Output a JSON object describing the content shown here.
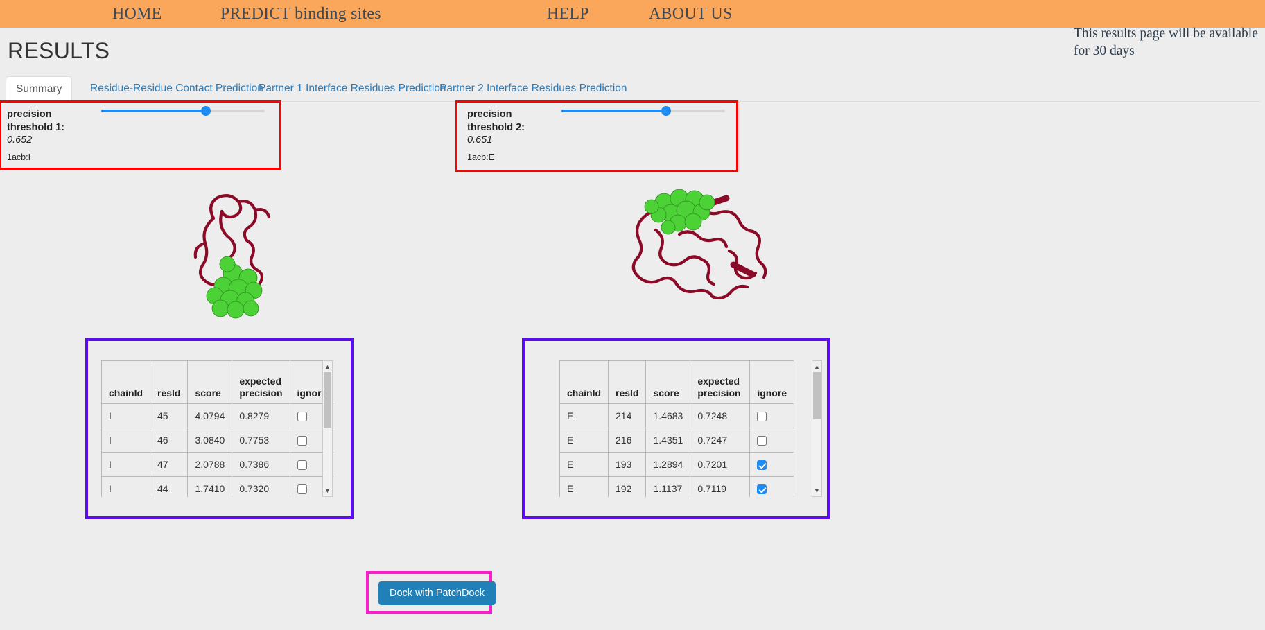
{
  "nav": {
    "items": [
      {
        "id": "home",
        "label": "HOME"
      },
      {
        "id": "predict",
        "label": "PREDICT binding sites"
      },
      {
        "id": "help",
        "label": "HELP"
      },
      {
        "id": "about",
        "label": "ABOUT US"
      }
    ]
  },
  "header": {
    "title": "RESULTS",
    "availability_note": "This results page will be available for 30 days"
  },
  "tabs": [
    {
      "id": "summary",
      "label": "Summary",
      "active": true
    },
    {
      "id": "rrcp",
      "label": "Residue-Residue Contact Prediction",
      "active": false
    },
    {
      "id": "p1",
      "label": "Partner 1 Interface Residues Prediction",
      "active": false
    },
    {
      "id": "p2",
      "label": "Partner 2 Interface Residues Prediction",
      "active": false
    }
  ],
  "panel1": {
    "threshold_label": "precision\nthreshold 1:",
    "threshold_value": "0.652",
    "chain_label": "1acb:I",
    "slider_percent": 64,
    "outline_color": "#fe0000",
    "slider_color": "#1d8bf1"
  },
  "panel2": {
    "threshold_label": "precision\nthreshold 2:",
    "threshold_value": "0.651",
    "chain_label": "1acb:E",
    "slider_percent": 64,
    "outline_color": "#fe0000",
    "slider_color": "#1d8bf1"
  },
  "table1": {
    "outline_color": "#5c0cf0",
    "columns": [
      "chainId",
      "resId",
      "score",
      "expected precision",
      "ignore"
    ],
    "rows": [
      {
        "chainId": "I",
        "resId": "45",
        "score": "4.0794",
        "precision": "0.8279",
        "ignore": false
      },
      {
        "chainId": "I",
        "resId": "46",
        "score": "3.0840",
        "precision": "0.7753",
        "ignore": false
      },
      {
        "chainId": "I",
        "resId": "47",
        "score": "2.0788",
        "precision": "0.7386",
        "ignore": false
      },
      {
        "chainId": "I",
        "resId": "44",
        "score": "1.7410",
        "precision": "0.7320",
        "ignore": false
      }
    ]
  },
  "table2": {
    "outline_color": "#5c0cf0",
    "columns": [
      "chainId",
      "resId",
      "score",
      "expected precision",
      "ignore"
    ],
    "rows": [
      {
        "chainId": "E",
        "resId": "214",
        "score": "1.4683",
        "precision": "0.7248",
        "ignore": false
      },
      {
        "chainId": "E",
        "resId": "216",
        "score": "1.4351",
        "precision": "0.7247",
        "ignore": false
      },
      {
        "chainId": "E",
        "resId": "193",
        "score": "1.2894",
        "precision": "0.7201",
        "ignore": true
      },
      {
        "chainId": "E",
        "resId": "192",
        "score": "1.1137",
        "precision": "0.7119",
        "ignore": true
      }
    ]
  },
  "dock": {
    "button_label": "Dock with PatchDock",
    "outline_color": "#ff1ccb",
    "button_color": "#2180b8"
  },
  "molecules": {
    "left": {
      "ribbon_color": "#8b0a28",
      "site_color": "#4cd137"
    },
    "right": {
      "ribbon_color": "#8b0a28",
      "site_color": "#4cd137"
    }
  },
  "scrollbars": {
    "up_arrow": "▲",
    "down_arrow": "▼"
  }
}
